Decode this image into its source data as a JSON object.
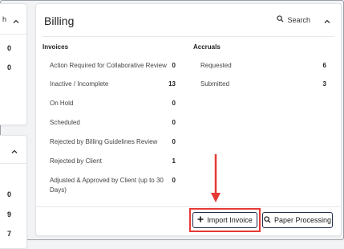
{
  "left_panel": {
    "top_card": {
      "header_fragment": "h",
      "values": [
        "0",
        "0"
      ]
    },
    "bottom_card": {
      "values": [
        "0",
        "9",
        "7"
      ]
    }
  },
  "billing": {
    "title": "Billing",
    "search_label": "Search",
    "invoices": {
      "heading": "Invoices",
      "rows": [
        {
          "label": "Action Required for Collaborative Review",
          "value": "0"
        },
        {
          "label": "Inactive / Incomplete",
          "value": "13"
        },
        {
          "label": "On Hold",
          "value": "0"
        },
        {
          "label": "Scheduled",
          "value": "0"
        },
        {
          "label": "Rejected by Billing Guidelines Review",
          "value": "0"
        },
        {
          "label": "Rejected by Client",
          "value": "1"
        },
        {
          "label": "Adjusted & Approved by Client (up to 30",
          "label_line2": "Days)",
          "value": "0"
        }
      ]
    },
    "accruals": {
      "heading": "Accruals",
      "rows": [
        {
          "label": "Requested",
          "value": "6"
        },
        {
          "label": "Submitted",
          "value": "3"
        }
      ]
    },
    "actions": {
      "import_invoice": "Import Invoice",
      "paper_processing": "Paper Processing"
    }
  },
  "annotation_color": "#e53935",
  "button_border_color": "#1f2d4a"
}
